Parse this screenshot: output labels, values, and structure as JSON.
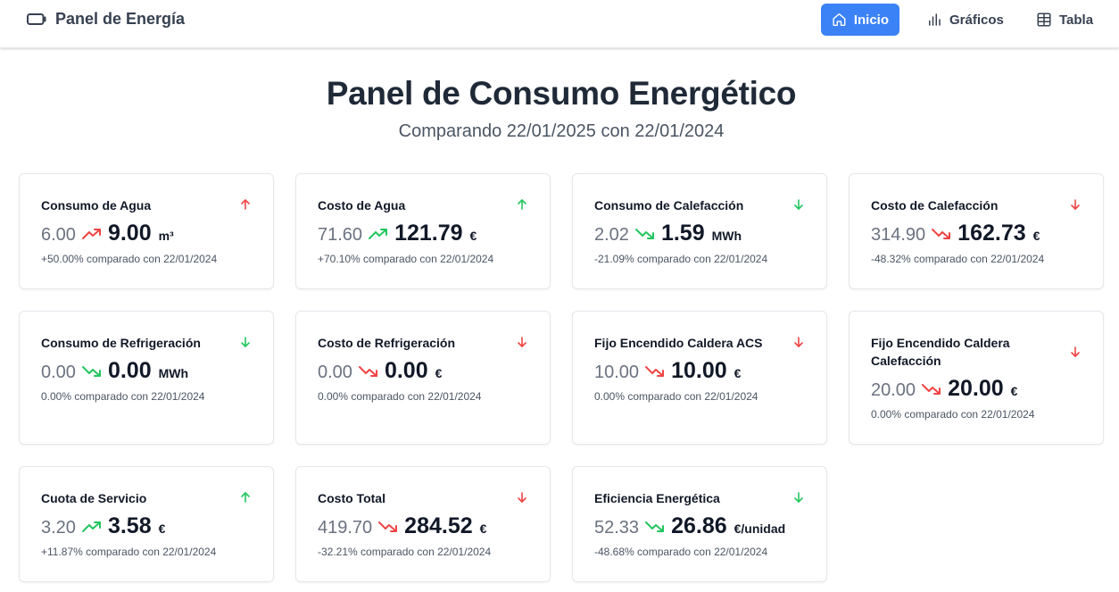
{
  "header": {
    "title": "Panel de Energía",
    "nav": [
      {
        "label": "Inicio",
        "icon": "home-icon",
        "active": true
      },
      {
        "label": "Gráficos",
        "icon": "bar-chart-icon",
        "active": false
      },
      {
        "label": "Tabla",
        "icon": "table-icon",
        "active": false
      }
    ]
  },
  "main": {
    "title": "Panel de Consumo Energético",
    "subtitle": "Comparando 22/01/2025 con 22/01/2024"
  },
  "colors": {
    "accent": "#3b82f6",
    "green": "#22c55e",
    "red": "#ef4444"
  },
  "cards": [
    {
      "title": "Consumo de Agua",
      "previous": "6.00",
      "current": "9.00",
      "unit": "m³",
      "comparison": "+50.00% comparado con 22/01/2024",
      "direction": "up",
      "status": "bad"
    },
    {
      "title": "Costo de Agua",
      "previous": "71.60",
      "current": "121.79",
      "unit": "€",
      "comparison": "+70.10% comparado con 22/01/2024",
      "direction": "up",
      "status": "good"
    },
    {
      "title": "Consumo de Calefacción",
      "previous": "2.02",
      "current": "1.59",
      "unit": "MWh",
      "comparison": "-21.09% comparado con 22/01/2024",
      "direction": "down",
      "status": "good"
    },
    {
      "title": "Costo de Calefacción",
      "previous": "314.90",
      "current": "162.73",
      "unit": "€",
      "comparison": "-48.32% comparado con 22/01/2024",
      "direction": "down",
      "status": "bad"
    },
    {
      "title": "Consumo de Refrigeración",
      "previous": "0.00",
      "current": "0.00",
      "unit": "MWh",
      "comparison": "0.00% comparado con 22/01/2024",
      "direction": "down",
      "status": "good"
    },
    {
      "title": "Costo de Refrigeración",
      "previous": "0.00",
      "current": "0.00",
      "unit": "€",
      "comparison": "0.00% comparado con 22/01/2024",
      "direction": "down",
      "status": "bad"
    },
    {
      "title": "Fijo Encendido Caldera ACS",
      "previous": "10.00",
      "current": "10.00",
      "unit": "€",
      "comparison": "0.00% comparado con 22/01/2024",
      "direction": "down",
      "status": "bad"
    },
    {
      "title": "Fijo Encendido Caldera Calefacción",
      "previous": "20.00",
      "current": "20.00",
      "unit": "€",
      "comparison": "0.00% comparado con 22/01/2024",
      "direction": "down",
      "status": "bad"
    },
    {
      "title": "Cuota de Servicio",
      "previous": "3.20",
      "current": "3.58",
      "unit": "€",
      "comparison": "+11.87% comparado con 22/01/2024",
      "direction": "up",
      "status": "good"
    },
    {
      "title": "Costo Total",
      "previous": "419.70",
      "current": "284.52",
      "unit": "€",
      "comparison": "-32.21% comparado con 22/01/2024",
      "direction": "down",
      "status": "bad"
    },
    {
      "title": "Eficiencia Energética",
      "previous": "52.33",
      "current": "26.86",
      "unit": "€/unidad",
      "comparison": "-48.68% comparado con 22/01/2024",
      "direction": "down",
      "status": "good"
    }
  ]
}
